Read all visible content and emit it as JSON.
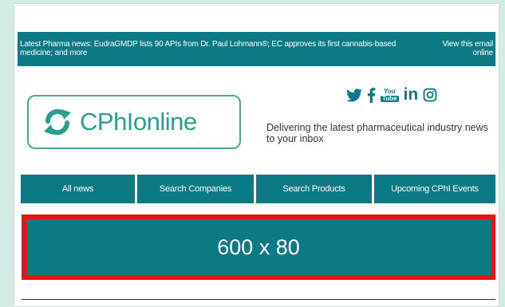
{
  "colors": {
    "page_background": "#d3ebe5",
    "brand_teal": "#0b7a84",
    "logo_teal": "#2a9d8f",
    "banner_border": "#ee1111"
  },
  "header": {
    "news_text": "Latest Pharma news: EudraGMDP lists 90 APIs from Dr. Paul Lohmann®; EC approves its first cannabis-based medicine; and more",
    "view_online_label": "View this email online"
  },
  "social": [
    {
      "icon": "twitter-icon"
    },
    {
      "icon": "facebook-icon"
    },
    {
      "icon": "youtube-icon",
      "label_top": "You",
      "label_bottom": "Tube"
    },
    {
      "icon": "linkedin-icon",
      "label": "in"
    },
    {
      "icon": "instagram-icon"
    }
  ],
  "logo": {
    "text_prefix": "CPhI",
    "text_suffix": "online"
  },
  "tagline": "Delivering the latest pharmaceutical industry news to your inbox",
  "nav": [
    {
      "label": "All news"
    },
    {
      "label": "Search Companies"
    },
    {
      "label": "Search Products"
    },
    {
      "label": "Upcoming CPhI Events"
    }
  ],
  "banner": {
    "label": "600 x 80"
  }
}
